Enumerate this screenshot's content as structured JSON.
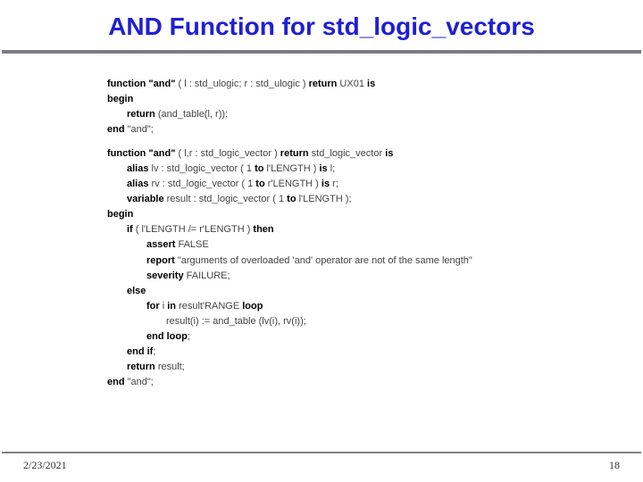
{
  "title": "AND Function for std_logic_vectors",
  "code": {
    "l1a": "function \"and\"",
    "l1b": " ( l : std_ulogic; r : std_ulogic ) ",
    "l1c": "return",
    "l1d": " UX01 ",
    "l1e": "is",
    "l2a": "begin",
    "l3a": "return",
    "l3b": " (and_table(l, r));",
    "l4a": "end",
    "l4b": " \"and\";",
    "l5a": "function \"and\"",
    "l5b": "  ( l,r : std_logic_vector ) ",
    "l5c": "return",
    "l5d": " std_logic_vector ",
    "l5e": "is",
    "l6a": "alias",
    "l6b": " lv : std_logic_vector ( 1 ",
    "l6c": "to",
    "l6d": " l'LENGTH ) ",
    "l6e": "is",
    "l6f": " l;",
    "l7a": "alias",
    "l7b": " rv : std_logic_vector ( 1 ",
    "l7c": "to",
    "l7d": " r'LENGTH ) ",
    "l7e": "is",
    "l7f": " r;",
    "l8a": "variable",
    "l8b": " result : std_logic_vector ( 1 ",
    "l8c": "to",
    "l8d": " l'LENGTH );",
    "l9a": "begin",
    "l10a": "if",
    "l10b": " ( l'LENGTH /= r'LENGTH ) ",
    "l10c": "then",
    "l11a": "assert",
    "l11b": " FALSE",
    "l12a": "report",
    "l12b": " \"arguments of overloaded 'and' operator are not of the same length\"",
    "l13a": "severity",
    "l13b": " FAILURE;",
    "l14a": "else",
    "l15a": "for",
    "l15b": " i ",
    "l15c": "in",
    "l15d": " result'RANGE ",
    "l15e": "loop",
    "l16a": "result(i) := and_table (lv(i), rv(i));",
    "l17a": "end loop",
    "l17b": ";",
    "l18a": "end if",
    "l18b": ";",
    "l19a": "return",
    "l19b": " result;",
    "l20a": "end",
    "l20b": " \"and\";"
  },
  "footer": {
    "date": "2/23/2021",
    "page": "18"
  }
}
